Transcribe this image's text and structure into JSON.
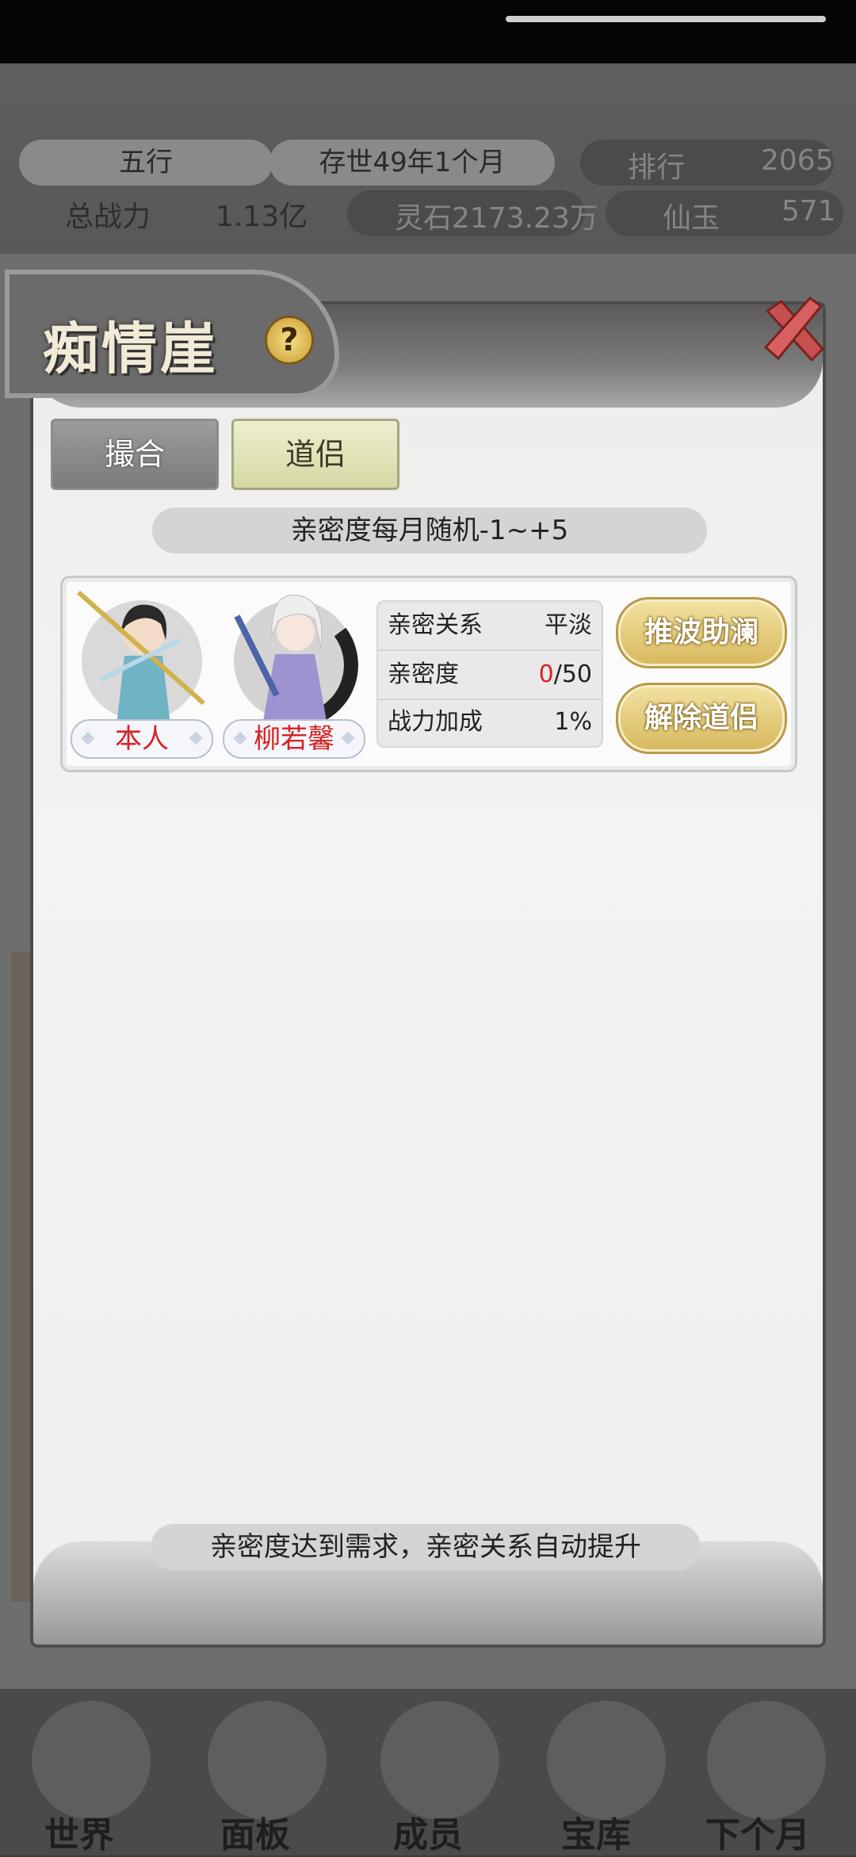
{
  "background": {
    "pill_wuxing": "五行",
    "pill_time": "存世49年1个月",
    "rank_label": "排行",
    "rank_value": "2065",
    "power_label": "总战力",
    "power_value": "1.13亿",
    "lingshi": "灵石2173.23万",
    "xianyu_label": "仙玉",
    "xianyu_value": "571",
    "nav": [
      "世界",
      "面板",
      "成员",
      "宝库",
      "下个月"
    ]
  },
  "dialog": {
    "title": "痴情崖",
    "help_icon": "?",
    "close_icon": "close-x-icon",
    "tabs": [
      {
        "label": "撮合",
        "active": false
      },
      {
        "label": "道侣",
        "active": true
      }
    ],
    "info_banner": "亲密度每月随机-1~+5",
    "footer_banner": "亲密度达到需求，亲密关系自动提升"
  },
  "partner_card": {
    "self_name": "本人",
    "partner_name": "柳若馨",
    "stats": [
      {
        "key": "亲密关系",
        "value": "平淡"
      },
      {
        "key": "亲密度",
        "value_current": "0",
        "value_max": "/50"
      },
      {
        "key": "战力加成",
        "value": "1%"
      }
    ],
    "buttons": {
      "boost": "推波助澜",
      "dissolve": "解除道侣"
    }
  },
  "colors": {
    "accent_gold": "#d7b85d",
    "name_red": "#d82222",
    "tab_active": "#d6d8a4"
  }
}
